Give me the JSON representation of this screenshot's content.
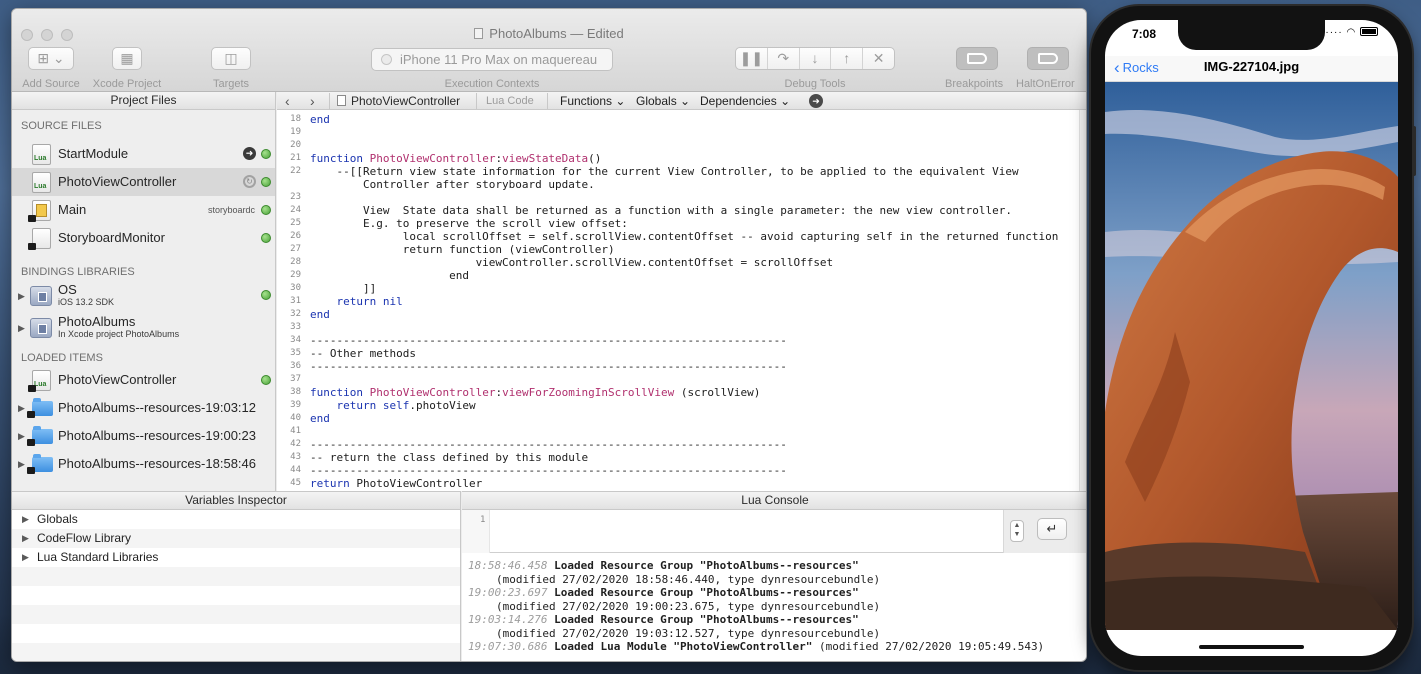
{
  "window": {
    "title": "PhotoAlbums — Edited",
    "toolbar": {
      "add_source": "Add Source",
      "xcode_project": "Xcode Project",
      "targets": "Targets",
      "execution_context_value": "iPhone 11 Pro Max on maquereau",
      "execution_contexts": "Execution Contexts",
      "debug_tools": "Debug Tools",
      "breakpoints": "Breakpoints",
      "halt_on_error": "HaltOnError"
    }
  },
  "project_files": {
    "header": "Project Files",
    "source_files_title": "SOURCE FILES",
    "source_files": [
      {
        "name": "StartModule"
      },
      {
        "name": "PhotoViewController"
      },
      {
        "name": "Main",
        "tag": "storyboardc"
      },
      {
        "name": "StoryboardMonitor"
      }
    ],
    "bindings_title": "BINDINGS LIBRARIES",
    "bindings": [
      {
        "name": "OS",
        "sub": "iOS 13.2 SDK"
      },
      {
        "name": "PhotoAlbums",
        "sub": "In Xcode project PhotoAlbums"
      }
    ],
    "loaded_title": "LOADED ITEMS",
    "loaded": [
      {
        "name": "PhotoViewController"
      },
      {
        "name": "PhotoAlbums--resources-19:03:12"
      },
      {
        "name": "PhotoAlbums--resources-19:00:23"
      },
      {
        "name": "PhotoAlbums--resources-18:58:46"
      }
    ]
  },
  "editor": {
    "jumpbar": {
      "file": "PhotoViewController",
      "language": "Lua Code",
      "functions": "Functions",
      "globals": "Globals",
      "dependencies": "Dependencies"
    },
    "lines": [
      {
        "n": "18",
        "t": "end"
      },
      {
        "n": "19",
        "t": ""
      },
      {
        "n": "20",
        "t": ""
      },
      {
        "n": "21",
        "t": "function PhotoViewController:viewStateData()"
      },
      {
        "n": "22",
        "t": "    --[[Return view state information for the current View Controller, to be applied to the equivalent View"
      },
      {
        "n": "",
        "t": "        Controller after storyboard update."
      },
      {
        "n": "23",
        "t": ""
      },
      {
        "n": "24",
        "t": "        View  State data shall be returned as a function with a single parameter: the new view controller."
      },
      {
        "n": "25",
        "t": "        E.g. to preserve the scroll view offset:"
      },
      {
        "n": "26",
        "t": "              local scrollOffset = self.scrollView.contentOffset -- avoid capturing self in the returned function"
      },
      {
        "n": "27",
        "t": "              return function (viewController)"
      },
      {
        "n": "28",
        "t": "                         viewController.scrollView.contentOffset = scrollOffset"
      },
      {
        "n": "29",
        "t": "                     end"
      },
      {
        "n": "30",
        "t": "        ]]"
      },
      {
        "n": "31",
        "t": "    return nil"
      },
      {
        "n": "32",
        "t": "end"
      },
      {
        "n": "33",
        "t": ""
      },
      {
        "n": "34",
        "t": "------------------------------------------------------------------------"
      },
      {
        "n": "35",
        "t": "-- Other methods"
      },
      {
        "n": "36",
        "t": "------------------------------------------------------------------------"
      },
      {
        "n": "37",
        "t": ""
      },
      {
        "n": "38",
        "t": "function PhotoViewController:viewForZoomingInScrollView (scrollView)"
      },
      {
        "n": "39",
        "t": "    return self.photoView"
      },
      {
        "n": "40",
        "t": "end"
      },
      {
        "n": "41",
        "t": ""
      },
      {
        "n": "42",
        "t": "------------------------------------------------------------------------"
      },
      {
        "n": "43",
        "t": "-- return the class defined by this module"
      },
      {
        "n": "44",
        "t": "------------------------------------------------------------------------"
      },
      {
        "n": "45",
        "t": "return PhotoViewController"
      }
    ]
  },
  "variables_inspector": {
    "header": "Variables Inspector",
    "items": [
      "Globals",
      "CodeFlow Library",
      "Lua Standard Libraries"
    ]
  },
  "lua_console": {
    "header": "Lua Console",
    "input_line_number": "1",
    "log": [
      {
        "time": "18:58:46.458",
        "msg": "Loaded Resource Group \"PhotoAlbums--resources\"",
        "detail": "(modified 27/02/2020 18:58:46.440, type dynresourcebundle)"
      },
      {
        "time": "19:00:23.697",
        "msg": "Loaded Resource Group \"PhotoAlbums--resources\"",
        "detail": "(modified 27/02/2020 19:00:23.675, type dynresourcebundle)"
      },
      {
        "time": "19:03:14.276",
        "msg": "Loaded Resource Group \"PhotoAlbums--resources\"",
        "detail": "(modified 27/02/2020 19:03:12.527, type dynresourcebundle)"
      },
      {
        "time": "19:07:30.686",
        "msg": "Loaded Lua Module \"PhotoViewController\"",
        "detail": "(modified 27/02/2020 19:05:49.543)"
      }
    ]
  },
  "iphone": {
    "time": "7:08",
    "back_label": "Rocks",
    "title": "IMG-227104.jpg"
  }
}
